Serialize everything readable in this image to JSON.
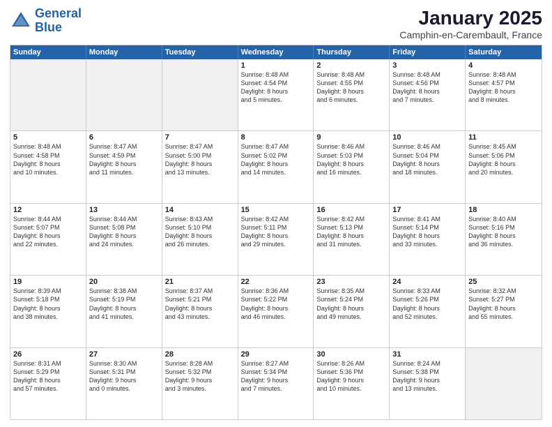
{
  "header": {
    "logo_line1": "General",
    "logo_line2": "Blue",
    "main_title": "January 2025",
    "subtitle": "Camphin-en-Carembault, France"
  },
  "days_of_week": [
    "Sunday",
    "Monday",
    "Tuesday",
    "Wednesday",
    "Thursday",
    "Friday",
    "Saturday"
  ],
  "weeks": [
    [
      {
        "day": "",
        "text": "",
        "shaded": true
      },
      {
        "day": "",
        "text": "",
        "shaded": true
      },
      {
        "day": "",
        "text": "",
        "shaded": true
      },
      {
        "day": "1",
        "text": "Sunrise: 8:48 AM\nSunset: 4:54 PM\nDaylight: 8 hours\nand 5 minutes."
      },
      {
        "day": "2",
        "text": "Sunrise: 8:48 AM\nSunset: 4:55 PM\nDaylight: 8 hours\nand 6 minutes."
      },
      {
        "day": "3",
        "text": "Sunrise: 8:48 AM\nSunset: 4:56 PM\nDaylight: 8 hours\nand 7 minutes."
      },
      {
        "day": "4",
        "text": "Sunrise: 8:48 AM\nSunset: 4:57 PM\nDaylight: 8 hours\nand 8 minutes."
      }
    ],
    [
      {
        "day": "5",
        "text": "Sunrise: 8:48 AM\nSunset: 4:58 PM\nDaylight: 8 hours\nand 10 minutes."
      },
      {
        "day": "6",
        "text": "Sunrise: 8:47 AM\nSunset: 4:59 PM\nDaylight: 8 hours\nand 11 minutes."
      },
      {
        "day": "7",
        "text": "Sunrise: 8:47 AM\nSunset: 5:00 PM\nDaylight: 8 hours\nand 13 minutes."
      },
      {
        "day": "8",
        "text": "Sunrise: 8:47 AM\nSunset: 5:02 PM\nDaylight: 8 hours\nand 14 minutes."
      },
      {
        "day": "9",
        "text": "Sunrise: 8:46 AM\nSunset: 5:03 PM\nDaylight: 8 hours\nand 16 minutes."
      },
      {
        "day": "10",
        "text": "Sunrise: 8:46 AM\nSunset: 5:04 PM\nDaylight: 8 hours\nand 18 minutes."
      },
      {
        "day": "11",
        "text": "Sunrise: 8:45 AM\nSunset: 5:06 PM\nDaylight: 8 hours\nand 20 minutes."
      }
    ],
    [
      {
        "day": "12",
        "text": "Sunrise: 8:44 AM\nSunset: 5:07 PM\nDaylight: 8 hours\nand 22 minutes."
      },
      {
        "day": "13",
        "text": "Sunrise: 8:44 AM\nSunset: 5:08 PM\nDaylight: 8 hours\nand 24 minutes."
      },
      {
        "day": "14",
        "text": "Sunrise: 8:43 AM\nSunset: 5:10 PM\nDaylight: 8 hours\nand 26 minutes."
      },
      {
        "day": "15",
        "text": "Sunrise: 8:42 AM\nSunset: 5:11 PM\nDaylight: 8 hours\nand 29 minutes."
      },
      {
        "day": "16",
        "text": "Sunrise: 8:42 AM\nSunset: 5:13 PM\nDaylight: 8 hours\nand 31 minutes."
      },
      {
        "day": "17",
        "text": "Sunrise: 8:41 AM\nSunset: 5:14 PM\nDaylight: 8 hours\nand 33 minutes."
      },
      {
        "day": "18",
        "text": "Sunrise: 8:40 AM\nSunset: 5:16 PM\nDaylight: 8 hours\nand 36 minutes."
      }
    ],
    [
      {
        "day": "19",
        "text": "Sunrise: 8:39 AM\nSunset: 5:18 PM\nDaylight: 8 hours\nand 38 minutes."
      },
      {
        "day": "20",
        "text": "Sunrise: 8:38 AM\nSunset: 5:19 PM\nDaylight: 8 hours\nand 41 minutes."
      },
      {
        "day": "21",
        "text": "Sunrise: 8:37 AM\nSunset: 5:21 PM\nDaylight: 8 hours\nand 43 minutes."
      },
      {
        "day": "22",
        "text": "Sunrise: 8:36 AM\nSunset: 5:22 PM\nDaylight: 8 hours\nand 46 minutes."
      },
      {
        "day": "23",
        "text": "Sunrise: 8:35 AM\nSunset: 5:24 PM\nDaylight: 8 hours\nand 49 minutes."
      },
      {
        "day": "24",
        "text": "Sunrise: 8:33 AM\nSunset: 5:26 PM\nDaylight: 8 hours\nand 52 minutes."
      },
      {
        "day": "25",
        "text": "Sunrise: 8:32 AM\nSunset: 5:27 PM\nDaylight: 8 hours\nand 55 minutes."
      }
    ],
    [
      {
        "day": "26",
        "text": "Sunrise: 8:31 AM\nSunset: 5:29 PM\nDaylight: 8 hours\nand 57 minutes."
      },
      {
        "day": "27",
        "text": "Sunrise: 8:30 AM\nSunset: 5:31 PM\nDaylight: 9 hours\nand 0 minutes."
      },
      {
        "day": "28",
        "text": "Sunrise: 8:28 AM\nSunset: 5:32 PM\nDaylight: 9 hours\nand 3 minutes."
      },
      {
        "day": "29",
        "text": "Sunrise: 8:27 AM\nSunset: 5:34 PM\nDaylight: 9 hours\nand 7 minutes."
      },
      {
        "day": "30",
        "text": "Sunrise: 8:26 AM\nSunset: 5:36 PM\nDaylight: 9 hours\nand 10 minutes."
      },
      {
        "day": "31",
        "text": "Sunrise: 8:24 AM\nSunset: 5:38 PM\nDaylight: 9 hours\nand 13 minutes."
      },
      {
        "day": "",
        "text": "",
        "shaded": true
      }
    ]
  ]
}
